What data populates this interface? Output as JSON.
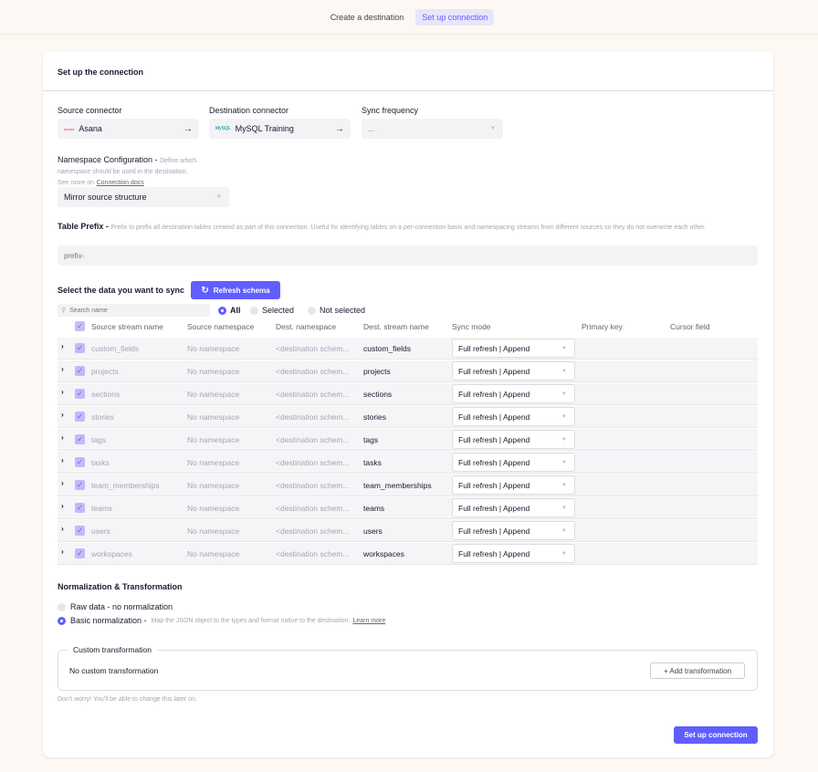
{
  "steps": [
    "Create a destination",
    "Set up connection"
  ],
  "card_title": "Set up the connection",
  "source": {
    "label": "Source connector",
    "value": "Asana",
    "logo": "asana"
  },
  "destination": {
    "label": "Destination connector",
    "value": "MySQL Training",
    "logo": "MySQL"
  },
  "frequency": {
    "label": "Sync frequency",
    "value": "..."
  },
  "namespace": {
    "label": "Namespace Configuration -",
    "hint": "Define which namespace should be used in the destination.",
    "see_more": "See more on",
    "docs_link": "Connection docs",
    "value": "Mirror source structure"
  },
  "prefix": {
    "label": "Table Prefix -",
    "hint": "Prefix to prefix all destination tables created as part of this connection. Useful for identifying tables on a per-connection basis and namespacing streams from different sources so they do not overwrite each other.",
    "placeholder": "prefix-"
  },
  "select_title": "Select the data you want to sync",
  "refresh_label": "Refresh schema",
  "search_placeholder": "Search name",
  "filters": [
    "All",
    "Selected",
    "Not selected"
  ],
  "columns": [
    "Source stream name",
    "Source namespace",
    "Dest. namespace",
    "Dest. stream name",
    "Sync mode",
    "Primary key",
    "Cursor field"
  ],
  "streams": [
    {
      "name": "custom_fields",
      "ns": "No namespace",
      "dest_ns": "<destination schem...",
      "dest": "custom_fields",
      "mode": "Full refresh | Append"
    },
    {
      "name": "projects",
      "ns": "No namespace",
      "dest_ns": "<destination schem...",
      "dest": "projects",
      "mode": "Full refresh | Append"
    },
    {
      "name": "sections",
      "ns": "No namespace",
      "dest_ns": "<destination schem...",
      "dest": "sections",
      "mode": "Full refresh | Append"
    },
    {
      "name": "stories",
      "ns": "No namespace",
      "dest_ns": "<destination schem...",
      "dest": "stories",
      "mode": "Full refresh | Append"
    },
    {
      "name": "tags",
      "ns": "No namespace",
      "dest_ns": "<destination schem...",
      "dest": "tags",
      "mode": "Full refresh | Append"
    },
    {
      "name": "tasks",
      "ns": "No namespace",
      "dest_ns": "<destination schem...",
      "dest": "tasks",
      "mode": "Full refresh | Append"
    },
    {
      "name": "team_memberships",
      "ns": "No namespace",
      "dest_ns": "<destination schem...",
      "dest": "team_memberships",
      "mode": "Full refresh | Append"
    },
    {
      "name": "teams",
      "ns": "No namespace",
      "dest_ns": "<destination schem...",
      "dest": "teams",
      "mode": "Full refresh | Append"
    },
    {
      "name": "users",
      "ns": "No namespace",
      "dest_ns": "<destination schem...",
      "dest": "users",
      "mode": "Full refresh | Append"
    },
    {
      "name": "workspaces",
      "ns": "No namespace",
      "dest_ns": "<destination schem...",
      "dest": "workspaces",
      "mode": "Full refresh | Append"
    }
  ],
  "normalization": {
    "title": "Normalization & Transformation",
    "raw": "Raw data - no normalization",
    "basic": "Basic normalization -",
    "basic_hint": "Map the JSON object to the types and format native to the destination.",
    "learn_more": "Learn more"
  },
  "custom": {
    "legend": "Custom transformation",
    "empty": "No custom transformation",
    "add": "+ Add transformation"
  },
  "note": "Don't worry! You'll be able to change this later on.",
  "submit": "Set up connection",
  "colors": {
    "accent": "#615eff",
    "background": "#fdf8f3"
  }
}
